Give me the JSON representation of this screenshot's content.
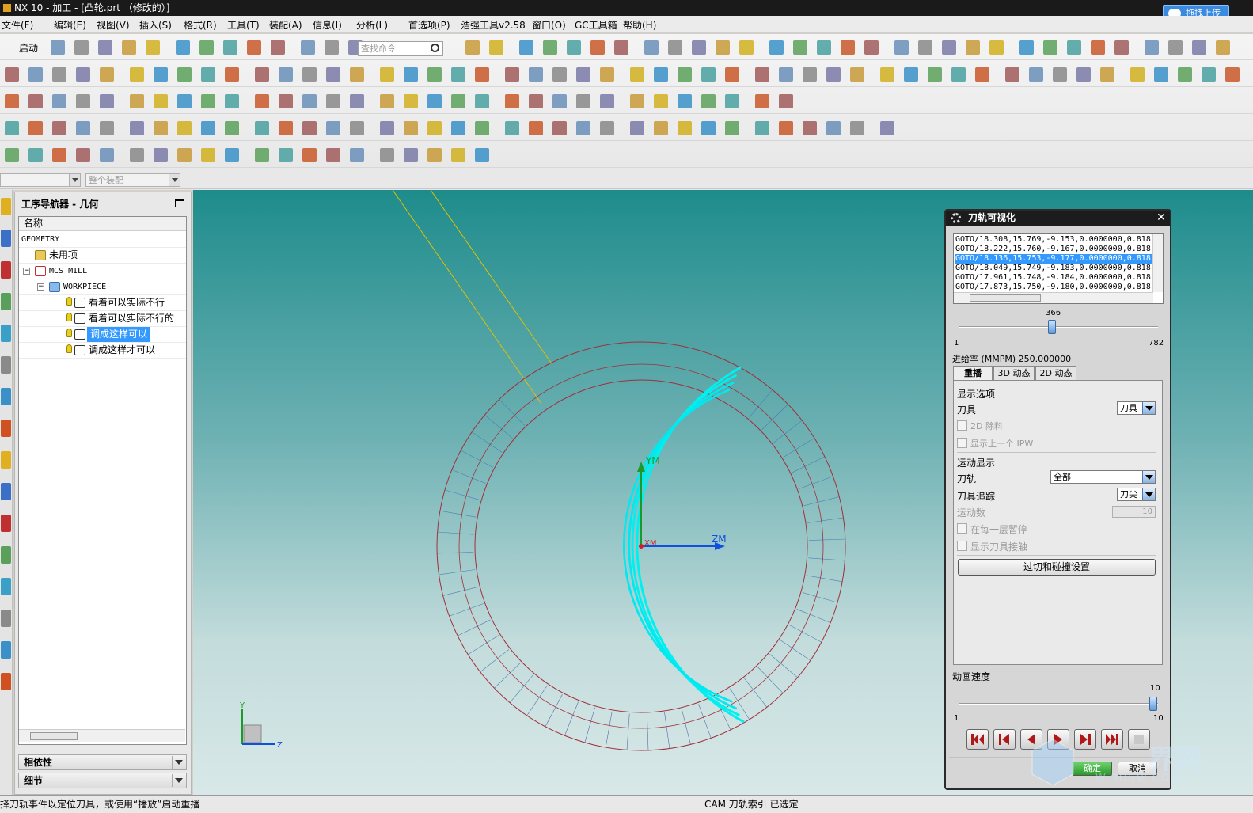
{
  "window": {
    "title": "NX 10 - 加工 - [凸轮.prt （修改的）]",
    "upload_button": "拖拽上传"
  },
  "menu": [
    "文件(F)",
    "编辑(E)",
    "视图(V)",
    "插入(S)",
    "格式(R)",
    "工具(T)",
    "装配(A)",
    "信息(I)",
    "分析(L)",
    "首选项(P)",
    "浩强工具v2.58",
    "窗口(O)",
    "GC工具箱",
    "帮助(H)"
  ],
  "toolbar": {
    "start_label": "启动",
    "search_placeholder": "查找命令",
    "assembly_filter": "整个装配"
  },
  "navigator": {
    "title": "工序导航器 - 几何",
    "column_header": "名称",
    "items": [
      {
        "label": "GEOMETRY",
        "level": 0,
        "type": "root"
      },
      {
        "label": "未用项",
        "level": 1,
        "type": "unused"
      },
      {
        "label": "MCS_MILL",
        "level": 1,
        "type": "mcs"
      },
      {
        "label": "WORKPIECE",
        "level": 2,
        "type": "workpiece"
      },
      {
        "label": "看着可以实际不行",
        "level": 3,
        "type": "operation"
      },
      {
        "label": "看着可以实际不行的",
        "level": 3,
        "type": "operation"
      },
      {
        "label": "调成这样可以",
        "level": 3,
        "type": "operation",
        "selected": true
      },
      {
        "label": "调成这样才可以",
        "level": 3,
        "type": "operation"
      }
    ],
    "panels": [
      "相依性",
      "细节"
    ]
  },
  "viewport": {
    "axis_y": "YM",
    "axis_z": "ZM",
    "axis_x": "XM",
    "triad_y": "Y",
    "triad_z": "Z"
  },
  "dialog": {
    "title": "刀轨可视化",
    "goto_lines": [
      "GOTO/18.308,15.769,-9.153,0.0000000,0.818",
      "GOTO/18.222,15.760,-9.167,0.0000000,0.818",
      "GOTO/18.136,15.753,-9.177,0.0000000,0.818",
      "GOTO/18.049,15.749,-9.183,0.0000000,0.818",
      "GOTO/17.961,15.748,-9.184,0.0000000,0.818",
      "GOTO/17.873,15.750,-9.180,0.0000000,0.818"
    ],
    "selected_line": 2,
    "position_slider": {
      "value": 366,
      "min": 1,
      "max": 782
    },
    "slider_value_label": "366",
    "slider_min_label": "1",
    "slider_max_label": "782",
    "feedrate_label": "进给率 (MMPM) 250.000000",
    "tabs": [
      "重播",
      "3D 动态",
      "2D 动态"
    ],
    "active_tab": 0,
    "display_options_label": "显示选项",
    "tool_label": "刀具",
    "tool_value": "刀具",
    "chk_2d_remove": "2D 除料",
    "chk_show_prev_ipw": "显示上一个 IPW",
    "motion_display_label": "运动显示",
    "toolpath_label": "刀轨",
    "toolpath_value": "全部",
    "tool_trace_label": "刀具追踪",
    "tool_trace_value": "刀尖",
    "motion_count_label": "运动数",
    "motion_count_value": "10",
    "chk_pause_layer": "在每一层暂停",
    "chk_show_contact": "显示刀具接触",
    "cut_collision_button": "过切和碰撞设置",
    "anim_speed_label": "动画速度",
    "anim_speed": {
      "value": 10,
      "min": 1,
      "max": 10
    },
    "anim_speed_value_label": "10",
    "anim_min_label": "1",
    "anim_max_label": "10",
    "ok_button": "确定",
    "cancel_button": "取消"
  },
  "status": {
    "left": "择刀轨事件以定位刀具，或使用“播放”启动重播",
    "right": "CAM 刀轨索引 已选定"
  },
  "watermark": {
    "brand": "界网",
    "url": "W.3DSW.COM"
  }
}
